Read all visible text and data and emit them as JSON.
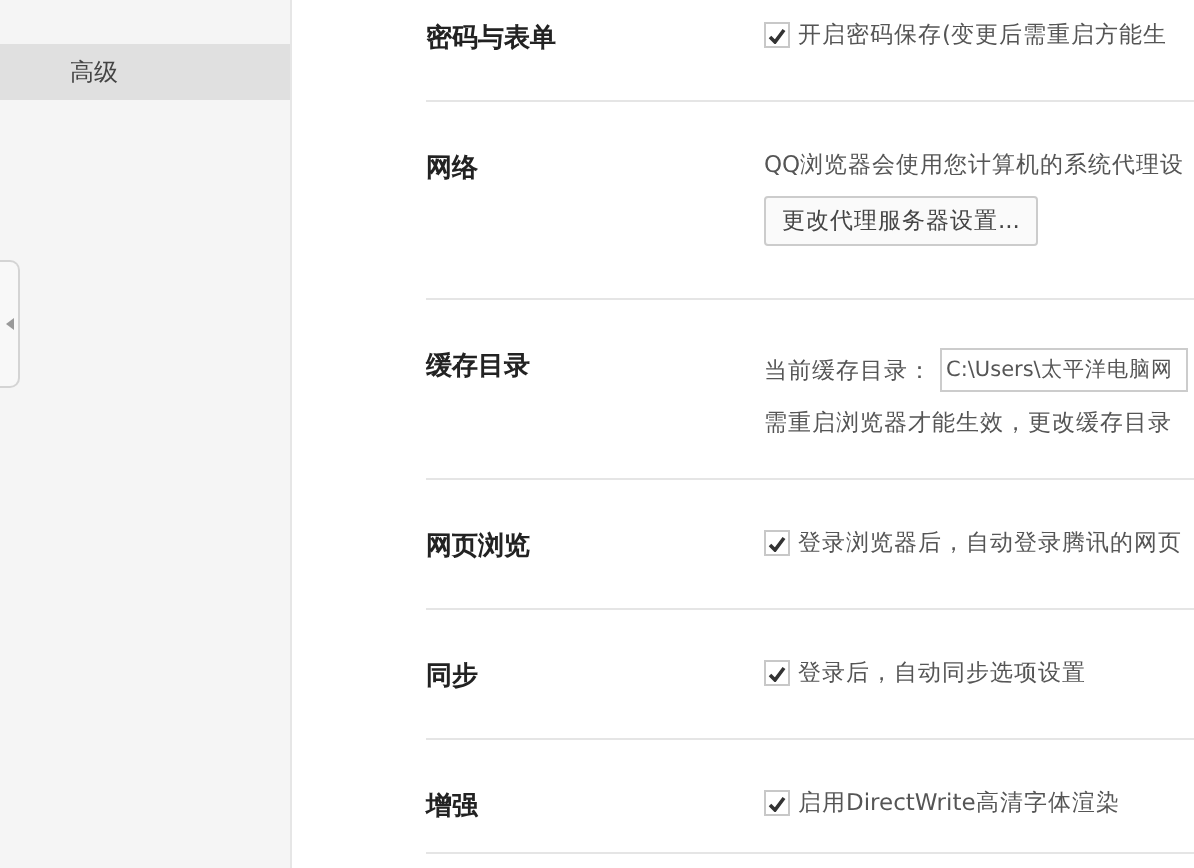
{
  "sidebar": {
    "items": [
      {
        "label": "高级",
        "selected": true
      }
    ]
  },
  "sections": [
    {
      "title": "密码与表单",
      "items": [
        {
          "kind": "checkbox",
          "label": "开启密码保存(变更后需重启方能生",
          "checked": true
        }
      ]
    },
    {
      "title": "网络",
      "items": [
        {
          "kind": "text",
          "label": "QQ浏览器会使用您计算机的系统代理设"
        },
        {
          "kind": "button",
          "label": "更改代理服务器设置..."
        }
      ]
    },
    {
      "title": "缓存目录",
      "items": [
        {
          "kind": "field",
          "label": "当前缓存目录：",
          "value": "C:\\Users\\太平洋电脑网"
        },
        {
          "kind": "text",
          "label": "需重启浏览器才能生效，更改缓存目录"
        }
      ]
    },
    {
      "title": "网页浏览",
      "items": [
        {
          "kind": "checkbox",
          "label": "登录浏览器后，自动登录腾讯的网页",
          "checked": true
        }
      ]
    },
    {
      "title": "同步",
      "items": [
        {
          "kind": "checkbox",
          "label": "登录后，自动同步选项设置",
          "checked": true
        }
      ]
    },
    {
      "title": "增强",
      "items": [
        {
          "kind": "checkbox",
          "label": "启用DirectWrite高清字体渲染",
          "checked": true
        }
      ]
    }
  ]
}
